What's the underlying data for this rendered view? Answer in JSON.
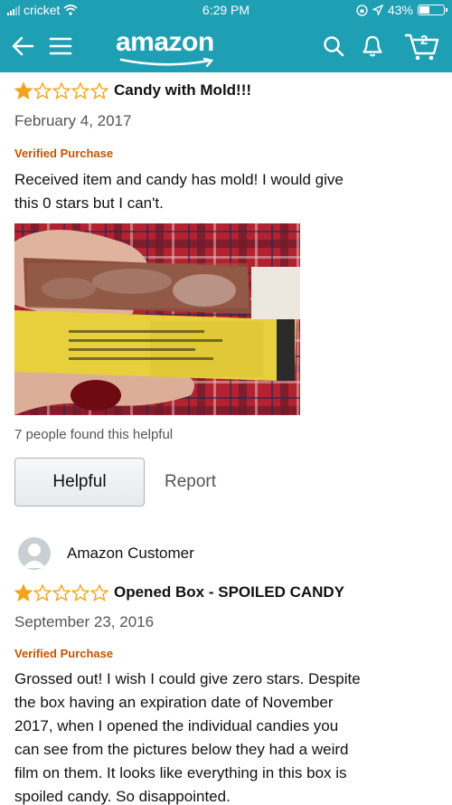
{
  "status_bar": {
    "carrier": "cricket",
    "time": "6:29 PM",
    "battery": "43%",
    "battery_level": 0.43
  },
  "nav": {
    "logo": "amazon",
    "cart_count": "2",
    "icons": [
      "back-arrow-icon",
      "menu-icon",
      "search-icon",
      "notification-bell-icon",
      "cart-icon"
    ]
  },
  "reviews": [
    {
      "rating": 1,
      "title": "Candy with Mold!!!",
      "date": "February 4, 2017",
      "verified": "Verified Purchase",
      "body": [
        "Received item and candy has mold! I would give",
        "this 0 stars but I can't."
      ],
      "helpful_count": "7 people found this helpful",
      "helpful_label": "Helpful",
      "report_label": "Report"
    },
    {
      "author": "Amazon Customer",
      "rating": 1,
      "title": "Opened Box - SPOILED CANDY",
      "date": "September 23, 2016",
      "verified": "Verified Purchase",
      "body": [
        "Grossed out! I wish I could give zero stars. Despite",
        "the box having an expiration date of November",
        "2017, when I opened the individual candies you",
        "can see from the pictures below they had a weird",
        "film on them. It looks like everything in this box is",
        "spoiled candy. So disappointed."
      ]
    }
  ],
  "colors": {
    "header": "#1f9fb3",
    "star": "#f4a41c",
    "verified": "#c45500"
  }
}
